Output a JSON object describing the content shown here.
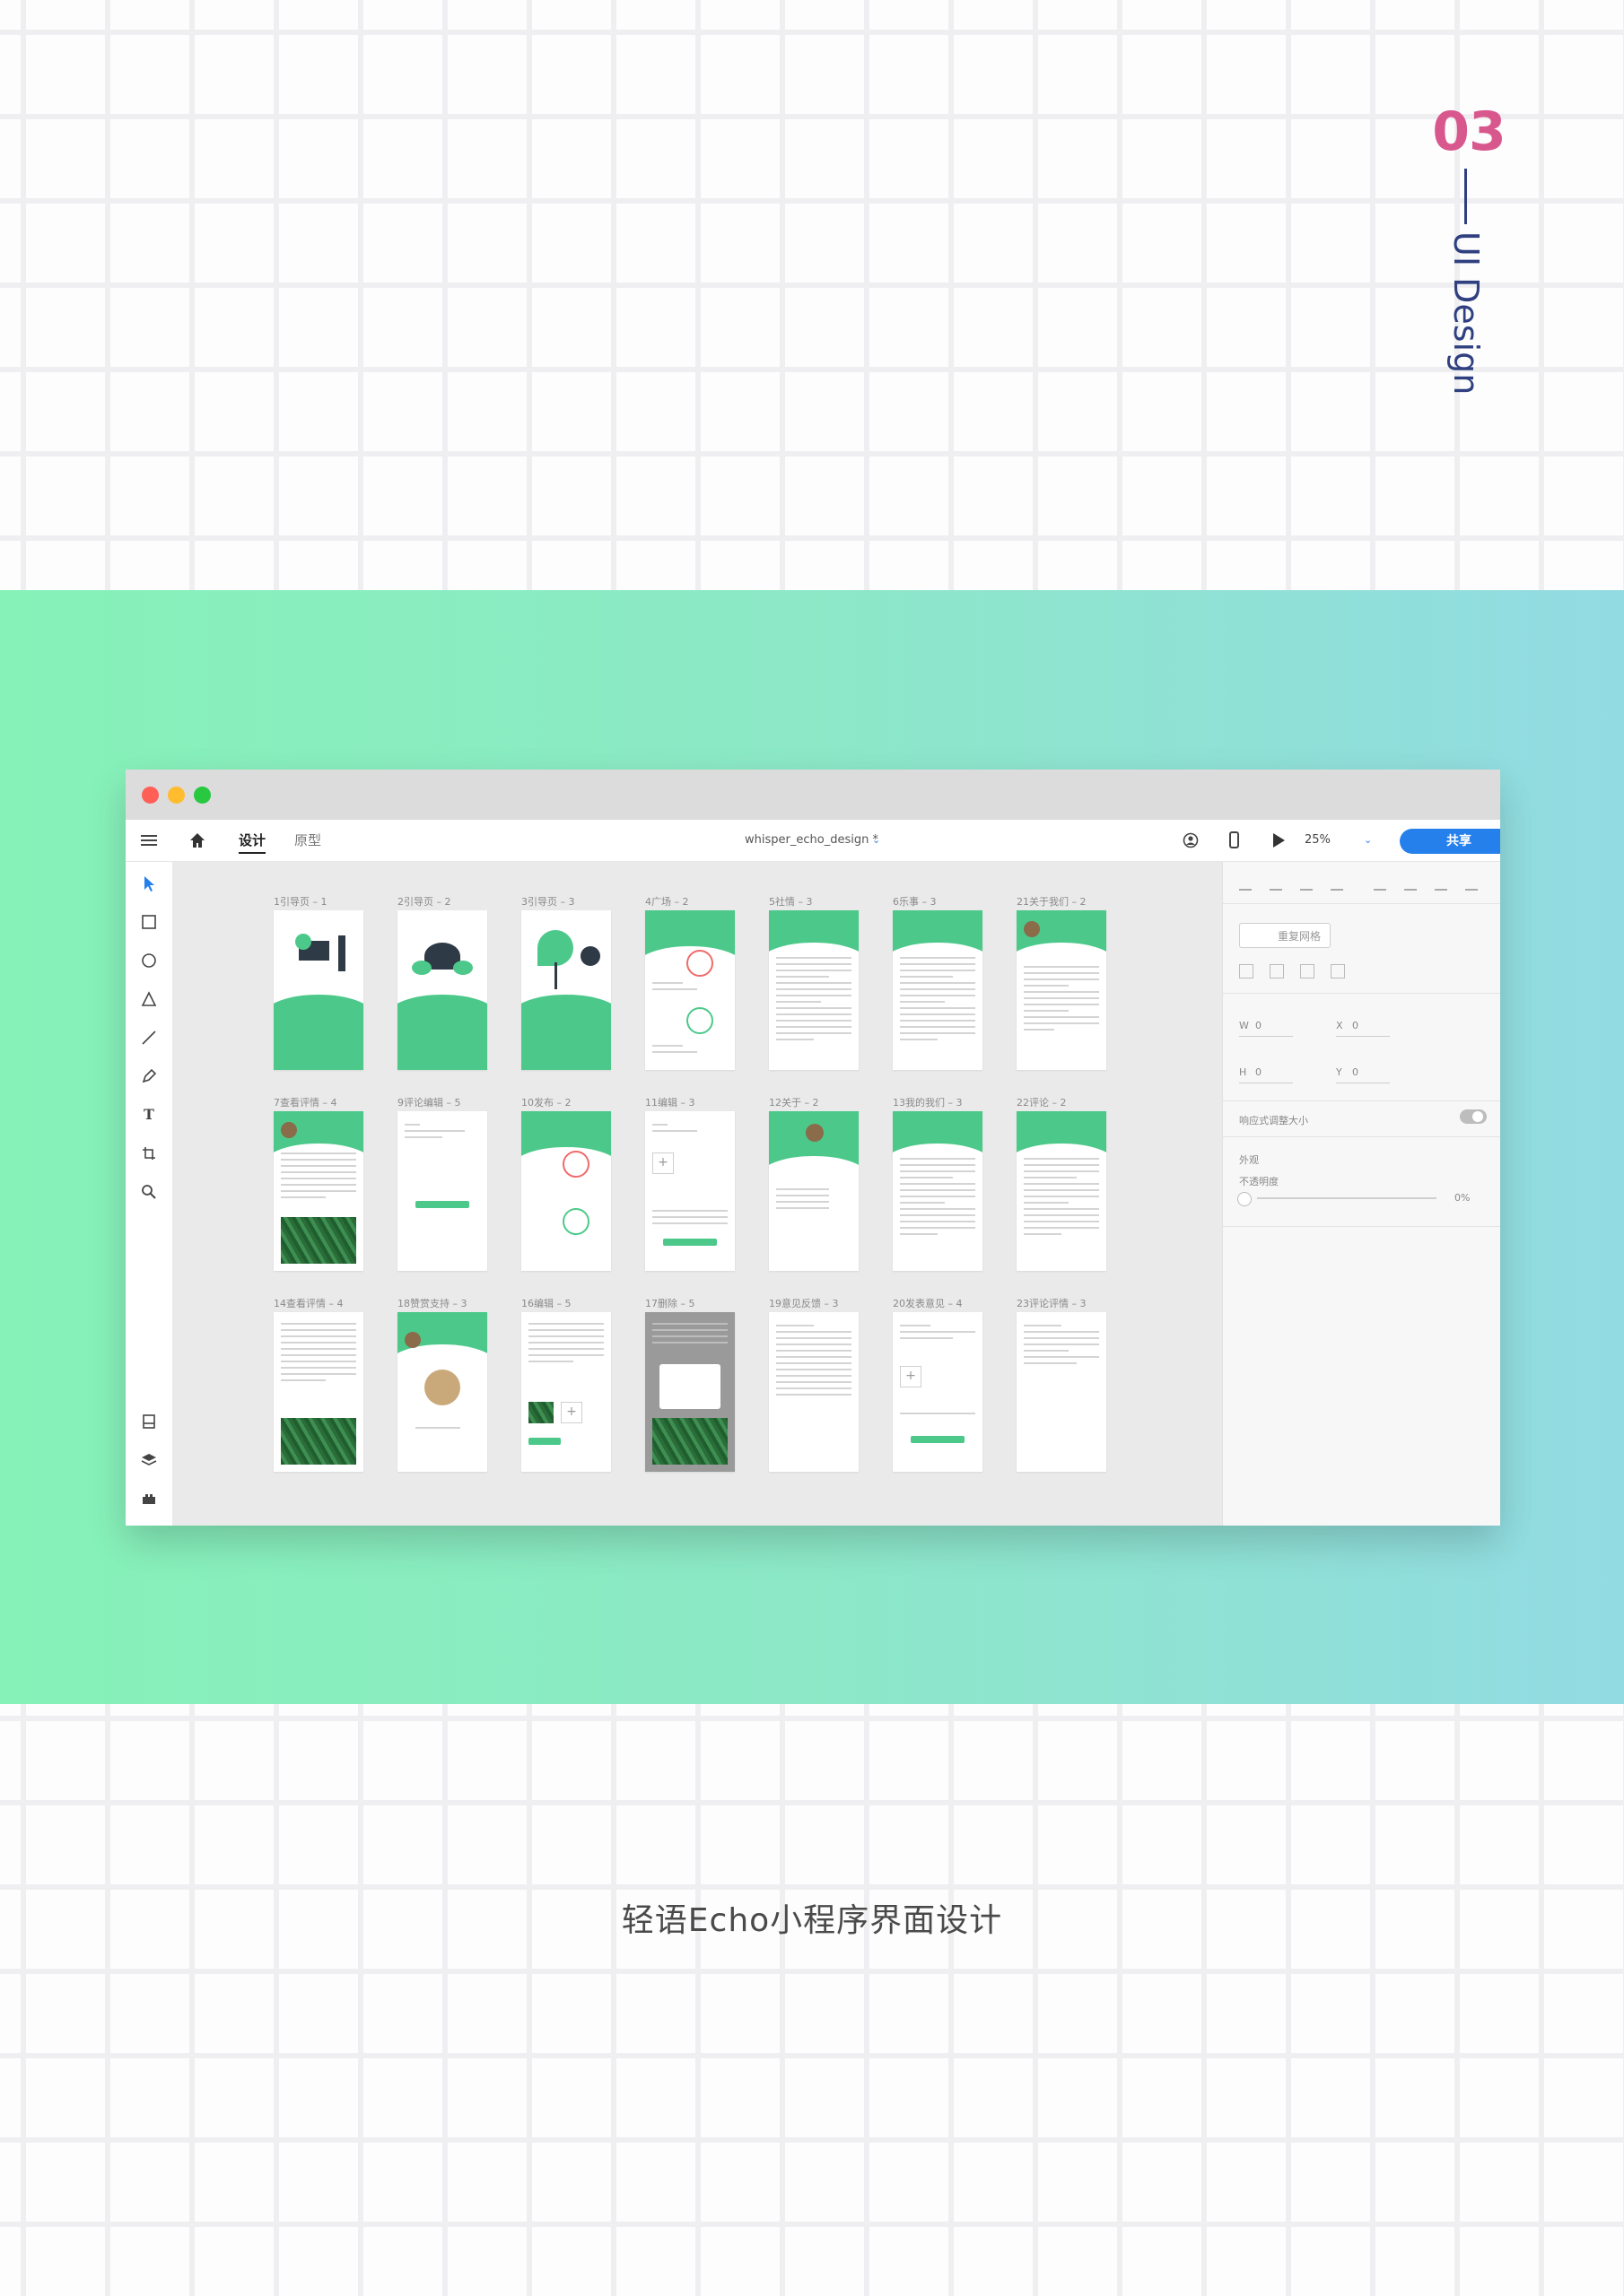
{
  "section": {
    "number": "03",
    "label": "UI Design"
  },
  "window": {
    "tabs": [
      "设计",
      "原型"
    ],
    "doc_name": "whisper_echo_design *",
    "zoom": "25%",
    "share_label": "共享"
  },
  "artboards": [
    [
      "1引导页 – 1",
      "2引导页 – 2",
      "3引导页 – 3",
      "4广场 – 2",
      "5社情 – 3",
      "6乐事 – 3",
      "21关于我们 – 2"
    ],
    [
      "7查看评情 – 4",
      "9评论编辑 – 5",
      "10发布 – 2",
      "11编辑 – 3",
      "12关于 – 2",
      "13我的我们 – 3",
      "22评论 – 2"
    ],
    [
      "14查看评情 – 4",
      "18赞赏支持 – 3",
      "16编辑 – 5",
      "17删除 – 5",
      "19意见反馈 – 3",
      "20发表意见 – 4",
      "23评论评情 – 3"
    ]
  ],
  "panel": {
    "repeat_grid": "重复网格",
    "w_label": "W",
    "w_value": "0",
    "h_label": "H",
    "h_value": "0",
    "x_label": "X",
    "x_value": "0",
    "y_label": "Y",
    "y_value": "0",
    "responsive": "响应式调整大小",
    "appearance": "外观",
    "opacity_label": "不透明度",
    "opacity_value": "0%"
  },
  "caption": "轻语Echo小程序界面设计",
  "colors": {
    "accent_pink": "#d8588d",
    "navy": "#2f3f80",
    "brand_green": "#4cc98a",
    "share_blue": "#2680eb"
  }
}
